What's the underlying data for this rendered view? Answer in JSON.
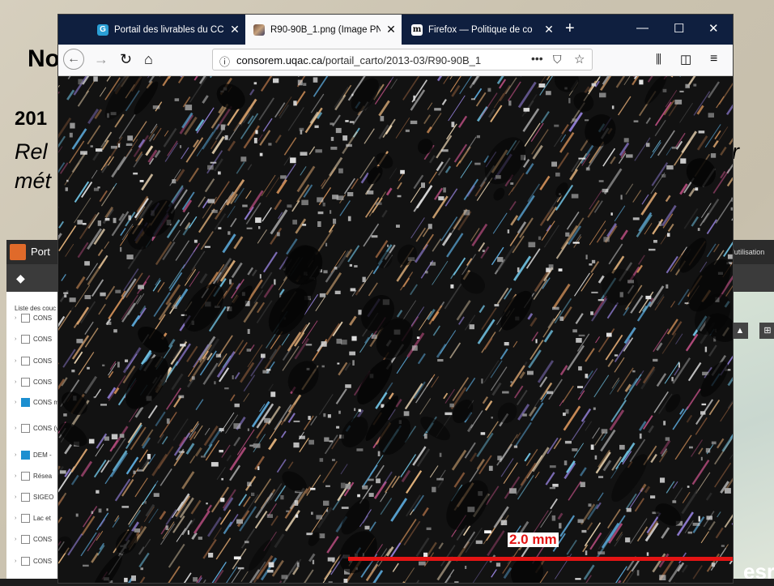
{
  "slide": {
    "title_fragment": "No",
    "year_fragment": "201",
    "subtitle_line1_fragment": "Rel",
    "subtitle_line2_fragment": "mét",
    "right_fragment": "r"
  },
  "background_app": {
    "title_fragment": "Port",
    "header_right_text": "l'utilisation",
    "layers_heading": "Liste des couc",
    "layers": [
      {
        "label": "CONS",
        "checked": false
      },
      {
        "label": "CONS",
        "checked": false
      },
      {
        "label": "CONS",
        "checked": false
      },
      {
        "label": "CONS",
        "checked": false
      },
      {
        "label": "CONS métar",
        "checked": true
      },
      {
        "label": "CONS (vecto",
        "checked": false
      },
      {
        "label": "DEM -",
        "checked": true
      },
      {
        "label": "Résea",
        "checked": false
      },
      {
        "label": "SIGEO",
        "checked": false
      },
      {
        "label": "Lac et",
        "checked": false
      },
      {
        "label": "CONS",
        "checked": false
      },
      {
        "label": "CONS",
        "checked": false
      }
    ],
    "map_watermark": "esri"
  },
  "browser": {
    "tabs": [
      {
        "label": "Portail des livrables du CC",
        "icon": "consorem-favicon",
        "active": false
      },
      {
        "label": "R90-90B_1.png (Image PN",
        "icon": "image-favicon",
        "active": true
      },
      {
        "label": "Firefox — Politique de co",
        "icon": "m-favicon",
        "active": false
      }
    ],
    "new_tab_label": "+",
    "url_domain": "consorem.uqac.ca",
    "url_path": "/portail_carto/2013-03/R90-90B_1",
    "url_more": "•••",
    "window_controls": {
      "minimize": "—",
      "maximize": "☐",
      "close": "✕"
    }
  },
  "image": {
    "filename": "R90-90B_1.png",
    "scale_label": "2.0 mm",
    "scale_color": "#e41414"
  }
}
